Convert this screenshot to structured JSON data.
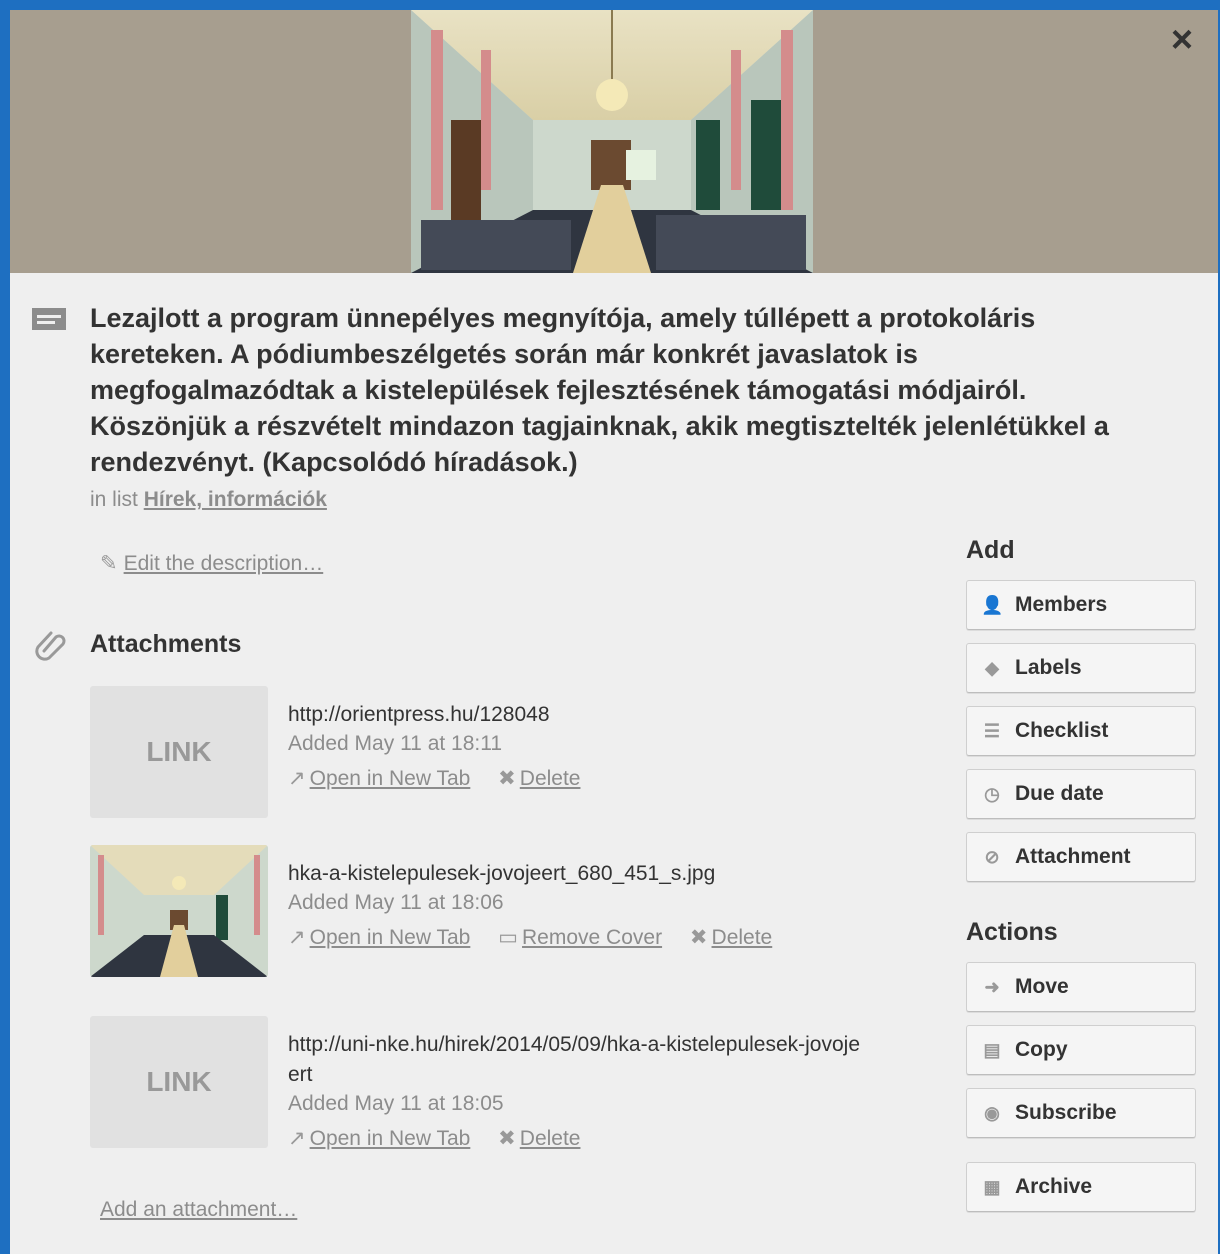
{
  "close_label": "×",
  "card": {
    "title": "Lezajlott a program ünnepélyes megnyítója, amely túllépett a protokoláris kereteken. A pódiumbeszélgetés során már konkrét javaslatok is megfogalmazódtak a kistelepülések fejlesztésének támogatási módjairól. Köszönjük a részvételt mindazon tagjainknak, akik megtisztelték jelenlétükkel a rendezvényt. (Kapcsolódó híradások.)",
    "in_list_prefix": "in list",
    "list_name": "Hírek, információk",
    "edit_description": "Edit the description…"
  },
  "attachments": {
    "heading": "Attachments",
    "items": [
      {
        "thumb_text": "LINK",
        "name": "http://orientpress.hu/128048",
        "date": "Added May 11 at 18:11",
        "open": "Open in New Tab",
        "delete": "Delete"
      },
      {
        "thumb_text": "",
        "name": "hka-a-kistelepulesek-jovojeert_680_451_s.jpg",
        "date": "Added May 11 at 18:06",
        "open": "Open in New Tab",
        "remove_cover": "Remove Cover",
        "delete": "Delete"
      },
      {
        "thumb_text": "LINK",
        "name": "http://uni-nke.hu/hirek/2014/05/09/hka-a-kistelepulesek-jovojeert",
        "date": "Added May 11 at 18:05",
        "open": "Open in New Tab",
        "delete": "Delete"
      }
    ],
    "add": "Add an attachment…"
  },
  "sidebar": {
    "add_heading": "Add",
    "add_buttons": [
      {
        "label": "Members",
        "icon": "person-icon"
      },
      {
        "label": "Labels",
        "icon": "tag-icon"
      },
      {
        "label": "Checklist",
        "icon": "checklist-icon"
      },
      {
        "label": "Due date",
        "icon": "clock-icon"
      },
      {
        "label": "Attachment",
        "icon": "paperclip-icon"
      }
    ],
    "actions_heading": "Actions",
    "action_buttons": [
      {
        "label": "Move",
        "icon": "arrow-right-icon"
      },
      {
        "label": "Copy",
        "icon": "copy-icon"
      },
      {
        "label": "Subscribe",
        "icon": "eye-icon"
      },
      {
        "label": "Archive",
        "icon": "archive-icon"
      }
    ]
  }
}
